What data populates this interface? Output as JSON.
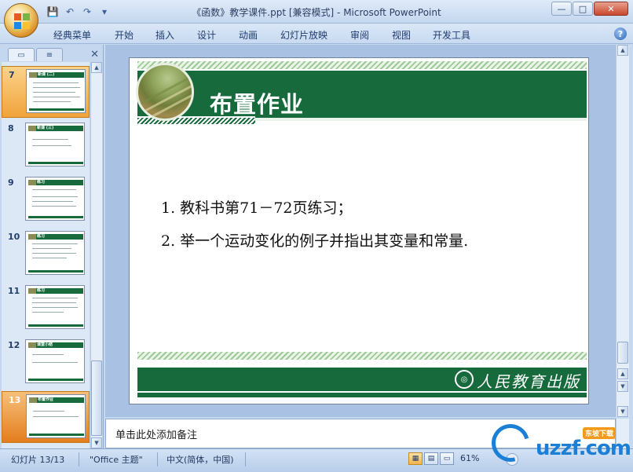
{
  "window": {
    "title": "《函数》教学课件.ppt [兼容模式] - Microsoft PowerPoint",
    "buttons": {
      "minimize": "—",
      "maximize": "□",
      "close": "✕"
    }
  },
  "quick_access": {
    "save": "💾",
    "undo": "↶",
    "redo": "↷",
    "customize": "▾"
  },
  "ribbon": {
    "tabs": [
      "经典菜单",
      "开始",
      "插入",
      "设计",
      "动画",
      "幻灯片放映",
      "审阅",
      "视图",
      "开发工具"
    ],
    "help": "?"
  },
  "left_panel": {
    "tab_slides": "▭",
    "tab_outline": "≡",
    "close": "✕",
    "thumbnails": [
      {
        "number": "7",
        "title": "新课 (二)"
      },
      {
        "number": "8",
        "title": "新课 (三)"
      },
      {
        "number": "9",
        "title": "练习"
      },
      {
        "number": "10",
        "title": "练习"
      },
      {
        "number": "11",
        "title": "练习"
      },
      {
        "number": "12",
        "title": "课堂小结"
      },
      {
        "number": "13",
        "title": "布置作业"
      }
    ],
    "selected": [
      "7",
      "13"
    ]
  },
  "slide": {
    "title": "布置作业",
    "lines": [
      "1. 教科书第71－72页练习；",
      "2. 举一个运动变化的例子并指出其变量和常量."
    ],
    "publisher": "人民教育出版社",
    "colors": {
      "green": "#166a3b",
      "stripe": "#9cc89a"
    }
  },
  "notes": {
    "placeholder": "单击此处添加备注"
  },
  "status_bar": {
    "slide_info": "幻灯片 13/13",
    "theme": "\"Office 主题\"",
    "language": "中文(简体，中国)",
    "zoom": "61%",
    "zoom_out": "−"
  },
  "watermark": {
    "text": "uzzf.com",
    "badge": "东坡下载"
  }
}
